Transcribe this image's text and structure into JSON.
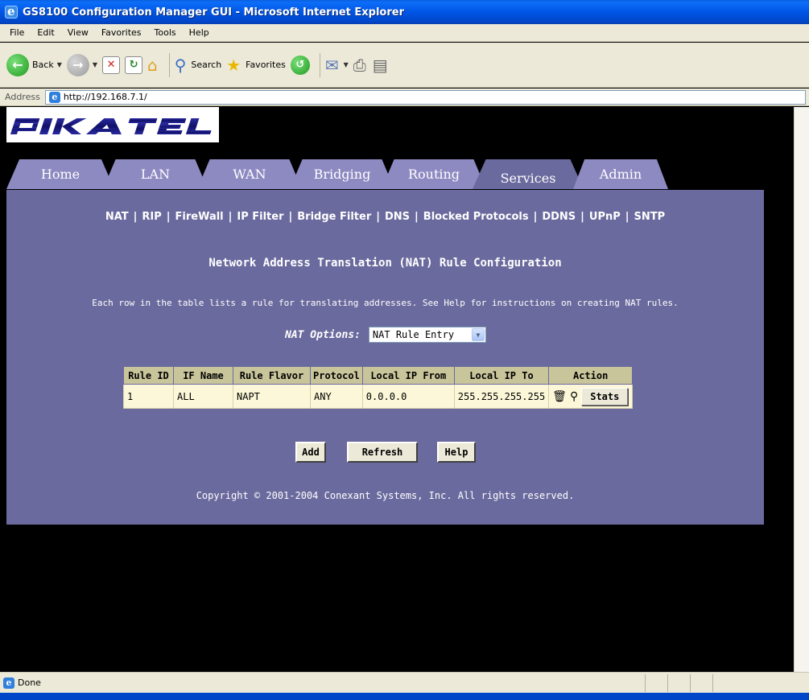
{
  "window": {
    "title": "GS8100 Configuration Manager GUI - Microsoft Internet Explorer"
  },
  "menu": [
    "File",
    "Edit",
    "View",
    "Favorites",
    "Tools",
    "Help"
  ],
  "toolbar": {
    "back": "Back",
    "search": "Search",
    "favorites": "Favorites"
  },
  "address": {
    "label": "Address",
    "url": "http://192.168.7.1/"
  },
  "logo": {
    "text": "PIKATEL"
  },
  "tabs": [
    {
      "label": "Home",
      "active": false
    },
    {
      "label": "LAN",
      "active": false
    },
    {
      "label": "WAN",
      "active": false
    },
    {
      "label": "Bridging",
      "active": false
    },
    {
      "label": "Routing",
      "active": false
    },
    {
      "label": "Services",
      "active": true
    },
    {
      "label": "Admin",
      "active": false
    }
  ],
  "subnav": [
    "NAT",
    "RIP",
    "FireWall",
    "IP Filter",
    "Bridge Filter",
    "DNS",
    "Blocked Protocols",
    "DDNS",
    "UPnP",
    "SNTP"
  ],
  "page": {
    "title": "Network Address Translation (NAT) Rule Configuration",
    "description": "Each row in the table lists a rule for translating addresses. See Help for instructions on creating NAT rules.",
    "options_label": "NAT Options:",
    "options_value": "NAT Rule Entry"
  },
  "table": {
    "headers": [
      "Rule ID",
      "IF Name",
      "Rule Flavor",
      "Protocol",
      "Local IP From",
      "Local IP To",
      "Action"
    ],
    "rows": [
      {
        "rule_id": "1",
        "if_name": "ALL",
        "flavor": "NAPT",
        "protocol": "ANY",
        "ip_from": "0.0.0.0",
        "ip_to": "255.255.255.255",
        "stats": "Stats"
      }
    ]
  },
  "buttons": {
    "add": "Add",
    "refresh": "Refresh",
    "help": "Help"
  },
  "copyright": "Copyright © 2001-2004 Conexant Systems, Inc. All rights reserved.",
  "status": {
    "text": "Done"
  },
  "colors": {
    "panel": "#6b6a9e",
    "tab": "#8d8ac2",
    "table_header": "#c9c59b",
    "table_row": "#fbf7d8"
  }
}
